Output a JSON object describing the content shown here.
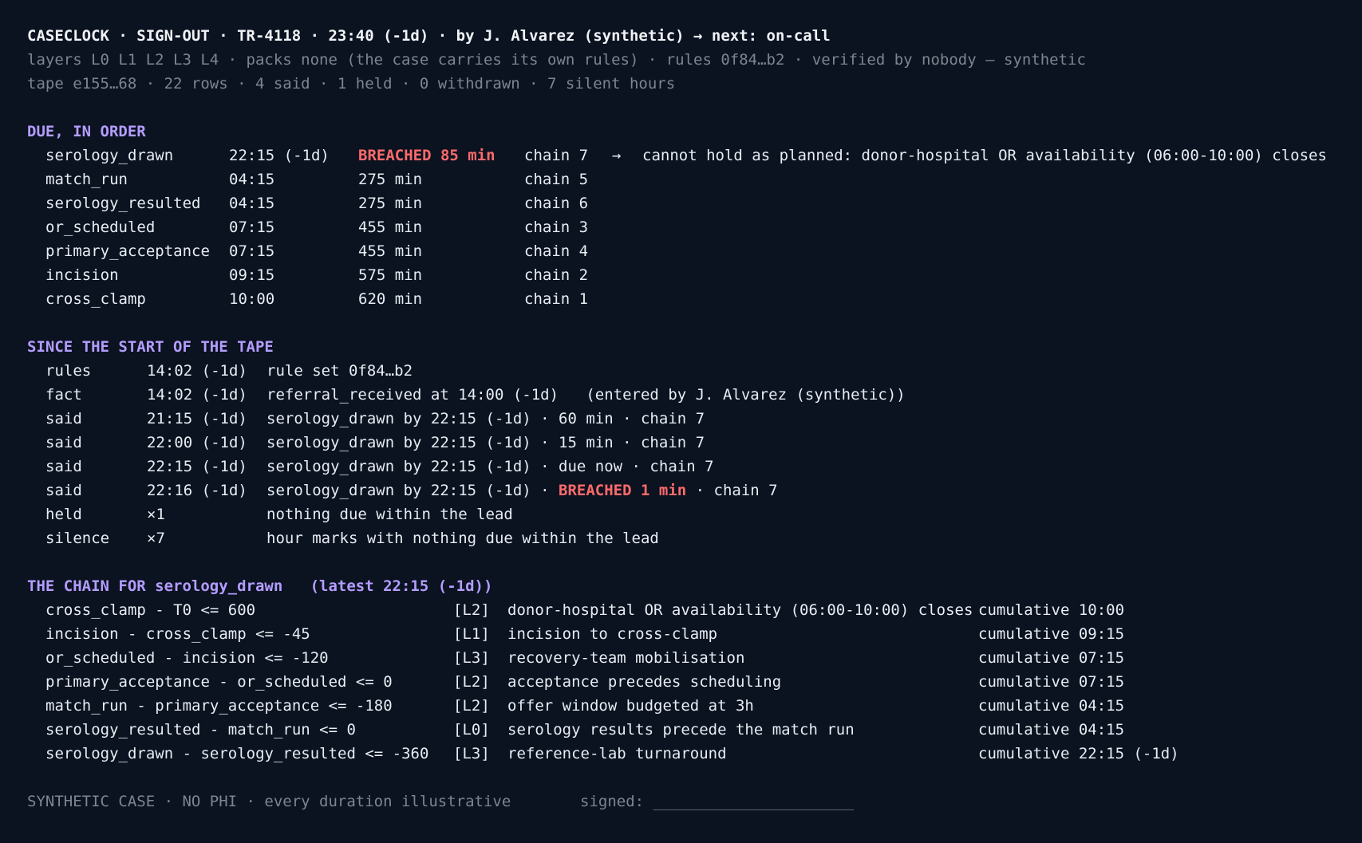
{
  "header": {
    "title": "CASECLOCK · SIGN-OUT · TR-4118 · 23:40 (-1d) · by J. Alvarez (synthetic) → next: on-call",
    "meta_line_1": "layers L0 L1 L2 L3 L4 · packs none (the case carries its own rules) · rules 0f84…b2 · verified by nobody — synthetic",
    "meta_line_2": "tape e155…68 · 22 rows · 4 said · 1 held · 0 withdrawn · 7 silent hours"
  },
  "due": {
    "heading": "DUE, IN ORDER",
    "rows": [
      {
        "name": "serology_drawn",
        "time": "22:15 (-1d)",
        "slack": "BREACHED 85 min",
        "breached": true,
        "chain": "chain 7",
        "arrow": "→",
        "note": "cannot hold as planned: donor-hospital OR availability (06:00-10:00) closes"
      },
      {
        "name": "match_run",
        "time": "04:15",
        "slack": "275 min",
        "breached": false,
        "chain": "chain 5",
        "arrow": "",
        "note": ""
      },
      {
        "name": "serology_resulted",
        "time": "04:15",
        "slack": "275 min",
        "breached": false,
        "chain": "chain 6",
        "arrow": "",
        "note": ""
      },
      {
        "name": "or_scheduled",
        "time": "07:15",
        "slack": "455 min",
        "breached": false,
        "chain": "chain 3",
        "arrow": "",
        "note": ""
      },
      {
        "name": "primary_acceptance",
        "time": "07:15",
        "slack": "455 min",
        "breached": false,
        "chain": "chain 4",
        "arrow": "",
        "note": ""
      },
      {
        "name": "incision",
        "time": "09:15",
        "slack": "575 min",
        "breached": false,
        "chain": "chain 2",
        "arrow": "",
        "note": ""
      },
      {
        "name": "cross_clamp",
        "time": "10:00",
        "slack": "620 min",
        "breached": false,
        "chain": "chain 1",
        "arrow": "",
        "note": ""
      }
    ]
  },
  "tape": {
    "heading": "SINCE THE START OF THE TAPE",
    "rows": [
      {
        "kind": "rules",
        "time": "14:02 (-1d)",
        "text": "rule set 0f84…b2",
        "breach": "",
        "tail": ""
      },
      {
        "kind": "fact",
        "time": "14:02 (-1d)",
        "text": "referral_received at 14:00 (-1d)   (entered by J. Alvarez (synthetic))",
        "breach": "",
        "tail": ""
      },
      {
        "kind": "said",
        "time": "21:15 (-1d)",
        "text": "serology_drawn by 22:15 (-1d) · 60 min · chain 7",
        "breach": "",
        "tail": ""
      },
      {
        "kind": "said",
        "time": "22:00 (-1d)",
        "text": "serology_drawn by 22:15 (-1d) · 15 min · chain 7",
        "breach": "",
        "tail": ""
      },
      {
        "kind": "said",
        "time": "22:15 (-1d)",
        "text": "serology_drawn by 22:15 (-1d) · due now · chain 7",
        "breach": "",
        "tail": ""
      },
      {
        "kind": "said",
        "time": "22:16 (-1d)",
        "text": "serology_drawn by 22:15 (-1d) · ",
        "breach": "BREACHED 1 min",
        "tail": " · chain 7"
      },
      {
        "kind": "held",
        "time": "×1",
        "text": "nothing due within the lead",
        "breach": "",
        "tail": ""
      },
      {
        "kind": "silence",
        "time": "×7",
        "text": "hour marks with nothing due within the lead",
        "breach": "",
        "tail": ""
      }
    ]
  },
  "chain": {
    "heading": "THE CHAIN FOR serology_drawn   (latest 22:15 (-1d))",
    "rows": [
      {
        "expr": "cross_clamp - T0 <= 600",
        "layer": "[L2]",
        "desc": "donor-hospital OR availability (06:00-10:00) closes",
        "cumulative": "cumulative 10:00"
      },
      {
        "expr": "incision - cross_clamp <= -45",
        "layer": "[L1]",
        "desc": "incision to cross-clamp",
        "cumulative": "cumulative 09:15"
      },
      {
        "expr": "or_scheduled - incision <= -120",
        "layer": "[L3]",
        "desc": "recovery-team mobilisation",
        "cumulative": "cumulative 07:15"
      },
      {
        "expr": "primary_acceptance - or_scheduled <= 0",
        "layer": "[L2]",
        "desc": "acceptance precedes scheduling",
        "cumulative": "cumulative 07:15"
      },
      {
        "expr": "match_run - primary_acceptance <= -180",
        "layer": "[L2]",
        "desc": "offer window budgeted at 3h",
        "cumulative": "cumulative 04:15"
      },
      {
        "expr": "serology_resulted - match_run <= 0",
        "layer": "[L0]",
        "desc": "serology results precede the match run",
        "cumulative": "cumulative 04:15"
      },
      {
        "expr": "serology_drawn - serology_resulted <= -360",
        "layer": "[L3]",
        "desc": "reference-lab turnaround",
        "cumulative": "cumulative 22:15 (-1d)"
      }
    ]
  },
  "footer": {
    "note": "SYNTHETIC CASE · NO PHI · every duration illustrative",
    "signed": "signed: ______________________"
  },
  "colors": {
    "background": "#0b1220",
    "text": "#e6edf3",
    "dim": "#7d8590",
    "heading": "#b39dff",
    "breach": "#ff6b6b"
  }
}
